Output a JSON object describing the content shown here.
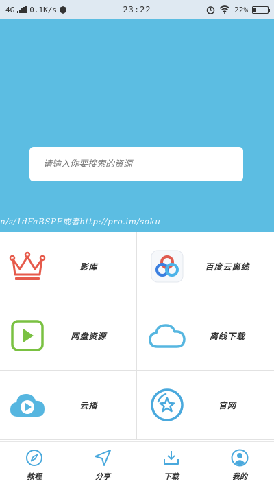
{
  "status_bar": {
    "network": "4G",
    "speed": "0.1K/s",
    "time": "23:22",
    "battery": "22%",
    "battery_level": 0.22
  },
  "search": {
    "placeholder": "请输入你要搜索的资源"
  },
  "hint": {
    "url_text": "n/s/1dFaBSPF或者http://pro.im/soku"
  },
  "grid": {
    "items": [
      {
        "label": "影库",
        "icon": "crown-icon"
      },
      {
        "label": "百度云离线",
        "icon": "baidu-cloud-icon"
      },
      {
        "label": "网盘资源",
        "icon": "play-square-icon"
      },
      {
        "label": "离线下载",
        "icon": "cloud-icon"
      },
      {
        "label": "云播",
        "icon": "cloud-play-icon"
      },
      {
        "label": "官网",
        "icon": "star-circle-icon"
      }
    ]
  },
  "bottom_nav": {
    "items": [
      {
        "label": "教程",
        "icon": "compass-icon"
      },
      {
        "label": "分享",
        "icon": "send-icon"
      },
      {
        "label": "下载",
        "icon": "download-icon"
      },
      {
        "label": "我的",
        "icon": "user-icon"
      }
    ]
  },
  "colors": {
    "hero": "#5cbde2",
    "accent_blue": "#4aa9dd",
    "crown_red": "#e65a4b",
    "green": "#7ac142"
  }
}
